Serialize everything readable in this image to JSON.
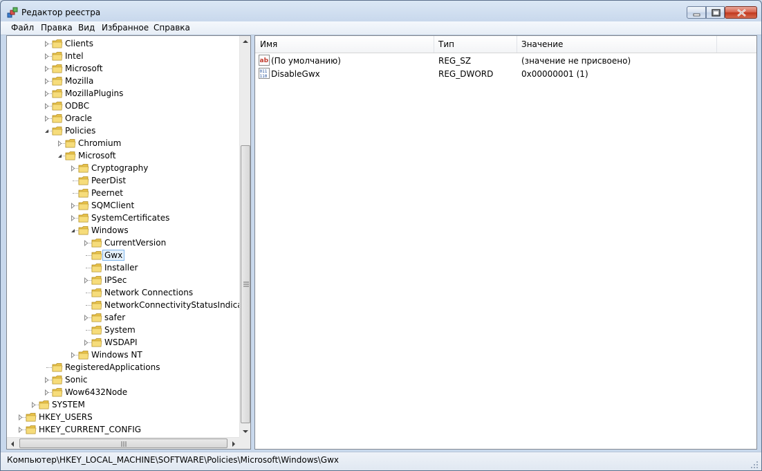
{
  "window": {
    "title": "Редактор реестра",
    "icon": "regedit-icon"
  },
  "menu": [
    "Файл",
    "Правка",
    "Вид",
    "Избранное",
    "Справка"
  ],
  "tree": [
    {
      "label": "Clients",
      "level": 3,
      "expander": "collapsed"
    },
    {
      "label": "Intel",
      "level": 3,
      "expander": "collapsed"
    },
    {
      "label": "Microsoft",
      "level": 3,
      "expander": "collapsed"
    },
    {
      "label": "Mozilla",
      "level": 3,
      "expander": "collapsed"
    },
    {
      "label": "MozillaPlugins",
      "level": 3,
      "expander": "collapsed"
    },
    {
      "label": "ODBC",
      "level": 3,
      "expander": "collapsed"
    },
    {
      "label": "Oracle",
      "level": 3,
      "expander": "collapsed"
    },
    {
      "label": "Policies",
      "level": 3,
      "expander": "expanded"
    },
    {
      "label": "Chromium",
      "level": 4,
      "expander": "collapsed"
    },
    {
      "label": "Microsoft",
      "level": 4,
      "expander": "expanded"
    },
    {
      "label": "Cryptography",
      "level": 5,
      "expander": "collapsed"
    },
    {
      "label": "PeerDist",
      "level": 5,
      "expander": "none"
    },
    {
      "label": "Peernet",
      "level": 5,
      "expander": "none"
    },
    {
      "label": "SQMClient",
      "level": 5,
      "expander": "collapsed"
    },
    {
      "label": "SystemCertificates",
      "level": 5,
      "expander": "collapsed"
    },
    {
      "label": "Windows",
      "level": 5,
      "expander": "expanded"
    },
    {
      "label": "CurrentVersion",
      "level": 6,
      "expander": "collapsed"
    },
    {
      "label": "Gwx",
      "level": 6,
      "expander": "none",
      "selected": true
    },
    {
      "label": "Installer",
      "level": 6,
      "expander": "none"
    },
    {
      "label": "IPSec",
      "level": 6,
      "expander": "collapsed"
    },
    {
      "label": "Network Connections",
      "level": 6,
      "expander": "none"
    },
    {
      "label": "NetworkConnectivityStatusIndicator",
      "level": 6,
      "expander": "none"
    },
    {
      "label": "safer",
      "level": 6,
      "expander": "collapsed"
    },
    {
      "label": "System",
      "level": 6,
      "expander": "none"
    },
    {
      "label": "WSDAPI",
      "level": 6,
      "expander": "collapsed"
    },
    {
      "label": "Windows NT",
      "level": 5,
      "expander": "collapsed"
    },
    {
      "label": "RegisteredApplications",
      "level": 3,
      "expander": "none"
    },
    {
      "label": "Sonic",
      "level": 3,
      "expander": "collapsed"
    },
    {
      "label": "Wow6432Node",
      "level": 3,
      "expander": "collapsed"
    },
    {
      "label": "SYSTEM",
      "level": 2,
      "expander": "collapsed"
    },
    {
      "label": "HKEY_USERS",
      "level": 1,
      "expander": "collapsed"
    },
    {
      "label": "HKEY_CURRENT_CONFIG",
      "level": 1,
      "expander": "collapsed"
    }
  ],
  "list": {
    "columns": [
      "Имя",
      "Тип",
      "Значение"
    ],
    "rows": [
      {
        "name": "(По умолчанию)",
        "type": "REG_SZ",
        "value": "(значение не присвоено)",
        "icon": "string-value-icon"
      },
      {
        "name": "DisableGwx",
        "type": "REG_DWORD",
        "value": "0x00000001 (1)",
        "icon": "dword-value-icon"
      }
    ]
  },
  "status": {
    "path": "Компьютер\\HKEY_LOCAL_MACHINE\\SOFTWARE\\Policies\\Microsoft\\Windows\\Gwx"
  },
  "colors": {
    "folder": "#e8c24a",
    "selection": "#e5f1fb",
    "selection_border": "#7eb4ea"
  }
}
